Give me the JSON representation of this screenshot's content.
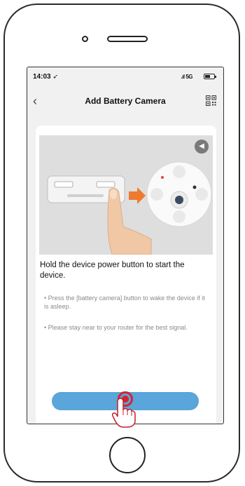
{
  "status_bar": {
    "time": "14:03",
    "time_arrow": "➶",
    "signal": "5G"
  },
  "nav": {
    "back_icon": "‹",
    "title": "Add Battery Camera"
  },
  "content": {
    "instruction": "Hold the device power button to start the device.",
    "tips": [
      "• Press the [battery camera] button to wake the device if it is asleep.",
      "• Please stay near to your router for the best signal."
    ]
  },
  "colors": {
    "primary_button": "#5aa5d9",
    "tap_indicator": "#d8222f"
  }
}
